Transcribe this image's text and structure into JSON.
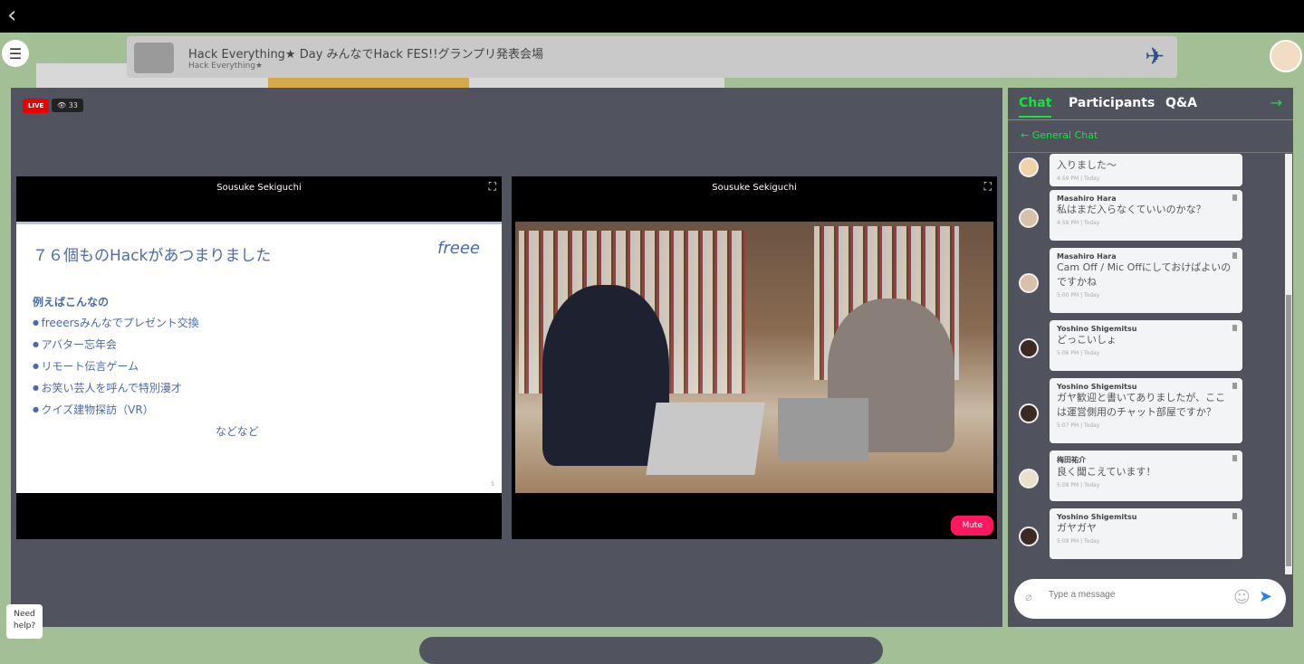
{
  "header": {
    "title": "Hack Everything★ Day みんなでHack FES!!グランプリ発表会場",
    "subtitle": "Hack Everything★"
  },
  "stage": {
    "live_label": "LIVE",
    "viewer_count": "33",
    "tiles": [
      {
        "name": "Sousuke Sekiguchi",
        "slide": {
          "title": "７６個ものHackがあつまりました",
          "logo": "freee",
          "subtitle": "例えばこんなの",
          "items": [
            "freeersみんなでプレゼント交換",
            "アバター忘年会",
            "リモート伝言ゲーム",
            "お笑い芸人を呼んで特別漫才",
            "クイズ建物探訪（VR）"
          ],
          "footer": "などなど",
          "page": "5"
        }
      },
      {
        "name": "Sousuke Sekiguchi",
        "mute_label": "Mute"
      }
    ]
  },
  "chat": {
    "tabs": [
      "Chat",
      "Participants",
      "Q&A"
    ],
    "channel": "General Chat",
    "messages": [
      {
        "author": "",
        "text": "入りました〜",
        "time": "4:59 PM | Today"
      },
      {
        "author": "Masahiro Hara",
        "text": "私はまだ入らなくていいのかな？",
        "time": "4:59 PM | Today"
      },
      {
        "author": "Masahiro Hara",
        "text": "Cam Off / Mic Offにしておけばよいのですかね",
        "time": "5:00 PM | Today"
      },
      {
        "author": "Yoshino Shigemitsu",
        "text": "どっこいしょ",
        "time": "5:06 PM | Today"
      },
      {
        "author": "Yoshino Shigemitsu",
        "text": "ガヤ歓迎と書いてありましたが、ここは運営側用のチャット部屋ですか？",
        "time": "5:07 PM | Today"
      },
      {
        "author": "梅田祐介",
        "text": "良く聞こえています！",
        "time": "5:08 PM | Today"
      },
      {
        "author": "Yoshino Shigemitsu",
        "text": "ガヤガヤ",
        "time": "5:09 PM | Today"
      }
    ],
    "placeholder": "Type a message"
  },
  "help": "Need help?"
}
